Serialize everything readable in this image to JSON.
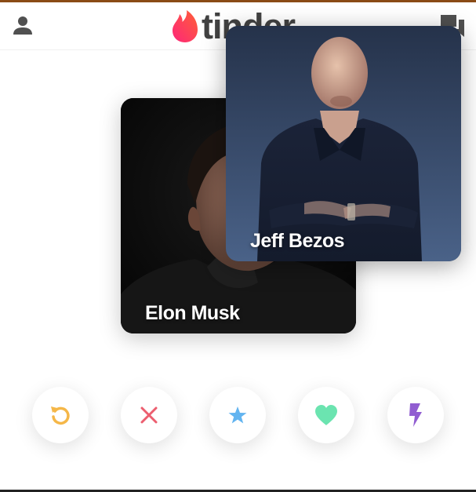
{
  "header": {
    "logo_text": "tinder",
    "profile_icon": "person-icon",
    "messages_icon": "chat-bubbles-icon"
  },
  "cards": [
    {
      "name": "Elon Musk"
    },
    {
      "name": "Jeff Bezos"
    }
  ],
  "actions": [
    {
      "icon": "rewind-icon",
      "color": "#f5b748"
    },
    {
      "icon": "close-icon",
      "color": "#ec5e6f"
    },
    {
      "icon": "star-icon",
      "color": "#62b4f0"
    },
    {
      "icon": "heart-icon",
      "color": "#6be4b0"
    },
    {
      "icon": "lightning-icon",
      "color": "#915dd1"
    }
  ],
  "colors": {
    "brand_gradient_start": "#fd267a",
    "brand_gradient_end": "#ff6036",
    "logo_text": "#424242",
    "header_icon": "#505050"
  }
}
